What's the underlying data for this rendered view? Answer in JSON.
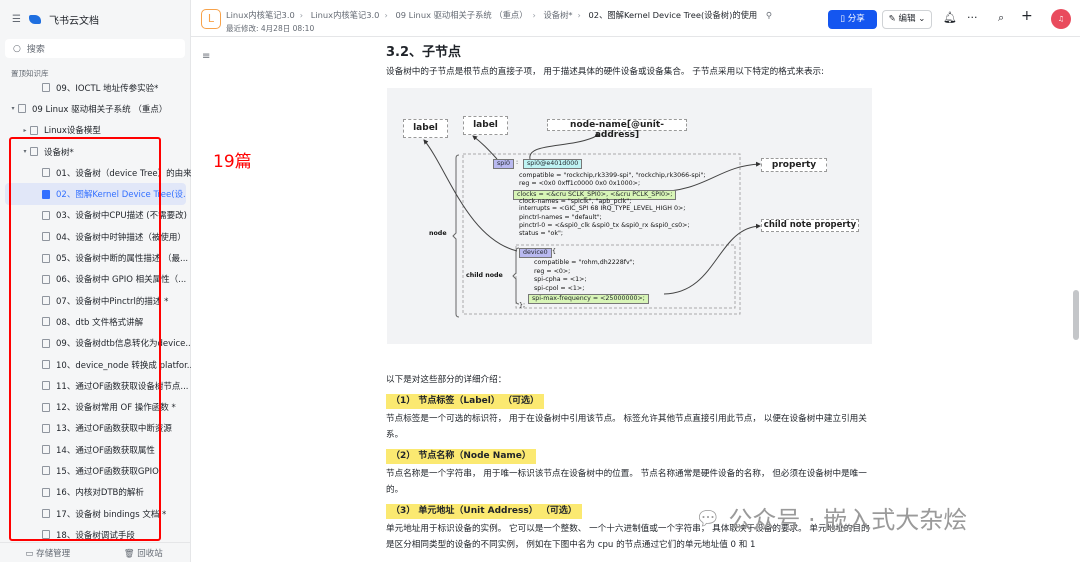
{
  "sidebar": {
    "app_name": "飞书云文档",
    "search_placeholder": "搜索",
    "section_label": "置顶知识库",
    "items": [
      {
        "label": "09、IOCTL 地址传参实验*",
        "level": 2
      },
      {
        "label": "09 Linux 驱动相关子系统 （重点）",
        "level": 0,
        "caret": "▾"
      },
      {
        "label": "Linux设备模型",
        "level": 1,
        "caret": "▸"
      },
      {
        "label": "设备树*",
        "level": 1,
        "caret": "▾"
      },
      {
        "label": "01、设备树（device Tree）的由来",
        "level": 2
      },
      {
        "label": "02、图解Kernel Device Tree(设...",
        "level": 2,
        "selected": true
      },
      {
        "label": "03、设备树中CPU描述 (不需要改)",
        "level": 2
      },
      {
        "label": "04、设备树中时钟描述（被使用）",
        "level": 2
      },
      {
        "label": "05、设备树中断的属性描述 （最...",
        "level": 2
      },
      {
        "label": "06、设备树中 GPIO 相关属性（...",
        "level": 2
      },
      {
        "label": "07、设备树中Pinctrl的描述 *",
        "level": 2
      },
      {
        "label": "08、dtb 文件格式讲解",
        "level": 2
      },
      {
        "label": "09、设备树dtb信息转化为device...",
        "level": 2
      },
      {
        "label": "10、device_node 转换成 platfor...",
        "level": 2
      },
      {
        "label": "11、通过OF函数获取设备树节点...",
        "level": 2
      },
      {
        "label": "12、设备树常用 OF 操作函数 *",
        "level": 2
      },
      {
        "label": "13、通过OF函数获取中断资源",
        "level": 2
      },
      {
        "label": "14、通过OF函数获取属性",
        "level": 2
      },
      {
        "label": "15、通过OF函数获取GPIO",
        "level": 2
      },
      {
        "label": "16、内核对DTB的解析",
        "level": 2
      },
      {
        "label": "17、设备树 bindings 文档 *",
        "level": 2
      },
      {
        "label": "18、设备树调试手段",
        "level": 2
      }
    ],
    "storage": "存储管理",
    "trash": "回收站"
  },
  "annotation": "19篇",
  "topbar": {
    "doc_icon": "L",
    "breadcrumbs": [
      "Linux内核笔记3.0",
      "Linux内核笔记3.0",
      "09 Linux 驱动相关子系统 （重点）",
      "设备树*",
      "02、图解Kernel Device Tree(设备树)的使用"
    ],
    "modified": "最近修改: 4月28日 08:10",
    "share": "分享",
    "edit": "编辑",
    "avatar": "♫"
  },
  "content": {
    "heading": "3.2、子节点",
    "intro": "设备树中的子节点是根节点的直接子项， 用于描述具体的硬件设备或设备集合。 子节点采用以下特定的格式来表示:",
    "after": "以下是对这些部分的详细介绍：",
    "s1": "（1） 节点标签（Label） （可选）",
    "p1": "节点标签是一个可选的标识符， 用于在设备树中引用该节点。 标签允许其他节点直接引用此节点， 以便在设备树中建立引用关系。",
    "s2": "（2） 节点名称（Node Name）",
    "p2": "节点名称是一个字符串， 用于唯一标识该节点在设备树中的位置。 节点名称通常是硬件设备的名称， 但必须在设备树中是唯一的。",
    "s3": "（3） 单元地址（Unit Address） （可选）",
    "p3": " 单元地址用于标识设备的实例。 它可以是一个整数、 一个十六进制值或一个字符串， 具体取决于设备的要求。 单元地址的目的是区分相同类型的设备的不同实例， 例如在下图中名为 cpu 的节点通过它们的单元地址值 0 和 1"
  },
  "diagram": {
    "label1": "label",
    "label2": "label",
    "node_name": "node-name[@unit-address]",
    "property": "property",
    "child_property": "child note property",
    "node": "node",
    "child_node": "child node",
    "spi0": "spi0",
    "colon": ":",
    "spi0_addr": "spi0@e401d000",
    "lines": [
      "compatible = \"rockchip,rk3399-spi\", \"rockchip,rk3066-spi\";",
      "reg = <0x0 0xff1c0000 0x0 0x1000>;",
      "clocks = <&cru SCLK_SPI0>, <&cru PCLK_SPI0>;",
      "clock-names = \"spiclk\", \"apb_pclk\";",
      "interrupts = <GIC_SPI 68 IRQ_TYPE_LEVEL_HIGH 0>;",
      "pinctrl-names = \"default\";",
      "pinctrl-0 = <&spi0_clk &spi0_tx &spi0_rx &spi0_cs0>;",
      "status = \"ok\";"
    ],
    "device0": "device0",
    "brace": "{",
    "child_lines": [
      "compatible = \"rohm,dh2228fv\";",
      "reg = <0>;",
      "spi-cpha = <1>;",
      "spi-cpol = <1>;",
      "spi-max-frequency = <25000000>;",
      "};"
    ]
  },
  "watermark": "公众号 · 嵌入式大杂烩"
}
